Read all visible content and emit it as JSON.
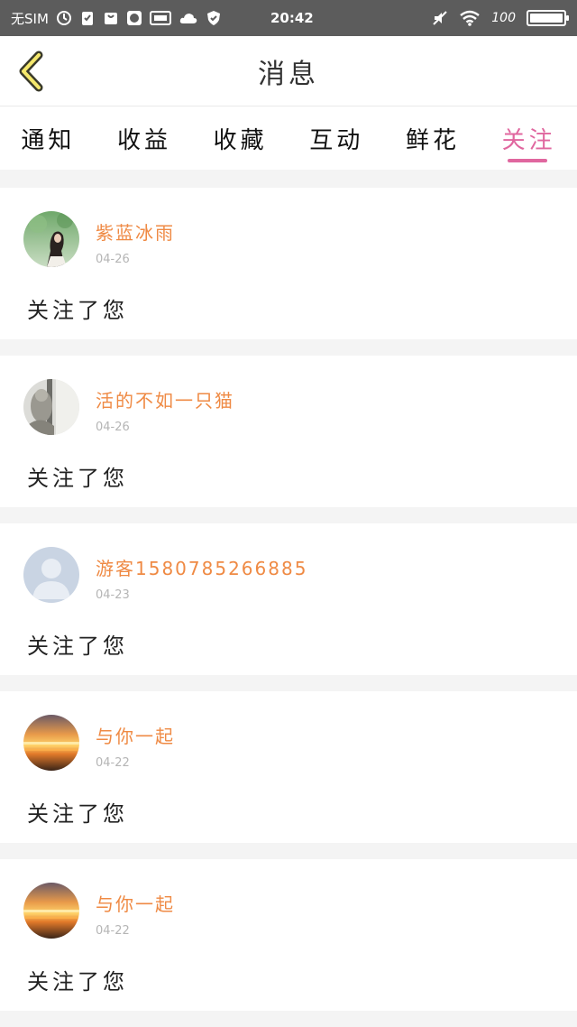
{
  "status_bar": {
    "sim": "无SIM",
    "time": "20:42",
    "battery": "100",
    "battery_level": 1.0
  },
  "header": {
    "title": "消息"
  },
  "tabs": [
    {
      "label": "通知"
    },
    {
      "label": "收益"
    },
    {
      "label": "收藏"
    },
    {
      "label": "互动"
    },
    {
      "label": "鲜花"
    },
    {
      "label": "关注"
    }
  ],
  "active_tab": "关注",
  "colors": {
    "accent": "#e0679f",
    "username": "#ef8a44"
  },
  "messages": [
    {
      "name": "紫蓝冰雨",
      "date": "04-26",
      "text": "关注了您",
      "avatar": "girl-photo"
    },
    {
      "name": "活的不如一只猫",
      "date": "04-26",
      "text": "关注了您",
      "avatar": "cat-photo"
    },
    {
      "name": "游客1580785266885",
      "date": "04-23",
      "text": "关注了您",
      "avatar": "default-person"
    },
    {
      "name": "与你一起",
      "date": "04-22",
      "text": "关注了您",
      "avatar": "sunset-photo"
    },
    {
      "name": "与你一起",
      "date": "04-22",
      "text": "关注了您",
      "avatar": "sunset-photo"
    }
  ]
}
